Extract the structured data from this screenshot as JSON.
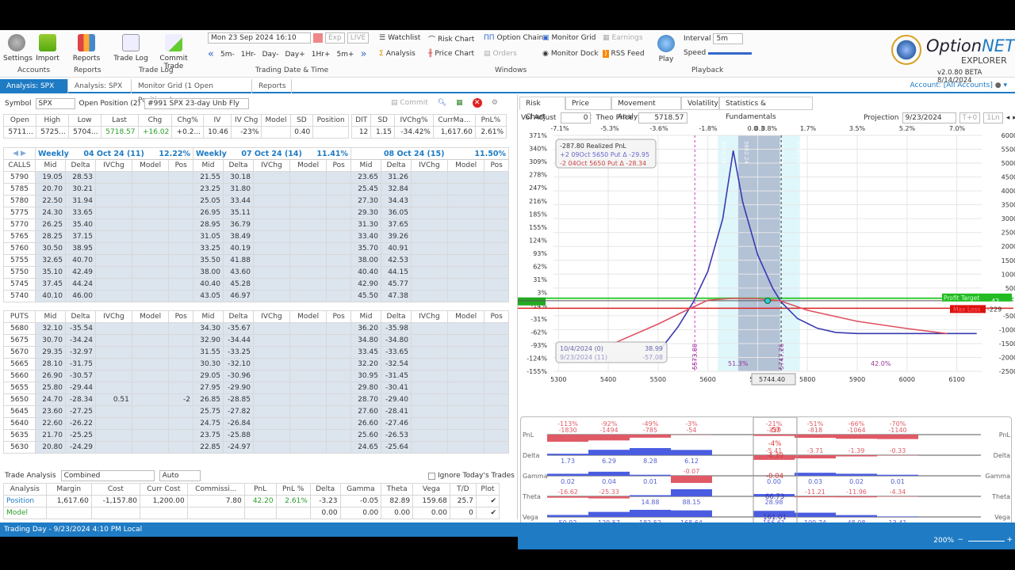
{
  "ribbon": {
    "accounts": {
      "settings": "Settings",
      "import": "Import",
      "group": "Accounts"
    },
    "reports": {
      "reports": "Reports",
      "group": "Reports"
    },
    "tradelog": {
      "trade_log": "Trade Log",
      "commit_trade": "Commit Trade",
      "group": "Trade Log"
    },
    "datetime": {
      "value": "Mon 23 Sep 2024 16:10",
      "exp": "Exp",
      "live": "LIVE",
      "steps": [
        "5m-",
        "1Hr-",
        "Day-",
        "Day+",
        "1Hr+",
        "5m+"
      ],
      "group": "Trading Date & Time"
    },
    "windows": {
      "items": [
        "Watchlist",
        "Risk Chart",
        "Option Chain",
        "Monitor Grid",
        "Earnings",
        "Analysis",
        "Price Chart",
        "Orders",
        "Monitor Dock",
        "RSS Feed"
      ],
      "group": "Windows"
    },
    "playback": {
      "play": "Play",
      "interval_label": "Interval",
      "interval": "5m",
      "speed_label": "Speed",
      "group": "Playback"
    },
    "logo": {
      "name1": "Option",
      "name2": "NET",
      "sub": "EXPLORER",
      "version": "v2.0.80 BETA 8/14/2024"
    }
  },
  "tabs": [
    "Analysis: SPX",
    "Analysis: SPX",
    "Monitor Grid (1 Open Positions)",
    "Reports"
  ],
  "account": "Account: [All Accounts]",
  "left": {
    "symbol_label": "Symbol",
    "symbol": "SPX",
    "open_position_label": "Open Position (2)",
    "position": "#991 SPX 23-day Unb Fly",
    "commit": "Commit",
    "quote_headers": [
      "Open",
      "High",
      "Low",
      "Last",
      "Chg",
      "Chg%",
      "IV",
      "IV Chg",
      "Model",
      "SD",
      "Position"
    ],
    "quote_values": [
      "5711...",
      "5725...",
      "5704...",
      "5718.57",
      "+16.02",
      "+0.2...",
      "10.46",
      "-23%",
      "",
      "0.40",
      ""
    ],
    "pos_headers": [
      "DIT",
      "SD",
      "IVChg%",
      "CurrMa...",
      "PnL%"
    ],
    "pos_values": [
      "12",
      "1.15",
      "-34.42%",
      "1,617.60",
      "2.61%"
    ],
    "expiries": [
      {
        "type": "Weekly",
        "date": "04 Oct 24 (11)",
        "iv": "12.22%"
      },
      {
        "type": "Weekly",
        "date": "07 Oct 24 (14)",
        "iv": "11.41%"
      },
      {
        "type": "",
        "date": "08 Oct 24 (15)",
        "iv": "11.50%"
      }
    ],
    "cols": [
      "Mid",
      "Delta",
      "IVChg",
      "Model",
      "Pos"
    ],
    "calls_label": "CALLS",
    "puts_label": "PUTS",
    "calls": [
      [
        "5790",
        "19.05",
        "28.53",
        "21.55",
        "30.18",
        "23.65",
        "31.26"
      ],
      [
        "5785",
        "20.70",
        "30.21",
        "23.25",
        "31.80",
        "25.45",
        "32.84"
      ],
      [
        "5780",
        "22.50",
        "31.94",
        "25.05",
        "33.44",
        "27.30",
        "34.43"
      ],
      [
        "5775",
        "24.30",
        "33.65",
        "26.95",
        "35.11",
        "29.30",
        "36.05"
      ],
      [
        "5770",
        "26.25",
        "35.40",
        "28.95",
        "36.79",
        "31.30",
        "37.65"
      ],
      [
        "5765",
        "28.25",
        "37.15",
        "31.05",
        "38.49",
        "33.40",
        "39.26"
      ],
      [
        "5760",
        "30.50",
        "38.95",
        "33.25",
        "40.19",
        "35.70",
        "40.91"
      ],
      [
        "5755",
        "32.65",
        "40.70",
        "35.50",
        "41.88",
        "38.00",
        "42.53"
      ],
      [
        "5750",
        "35.10",
        "42.49",
        "38.00",
        "43.60",
        "40.40",
        "44.15"
      ],
      [
        "5745",
        "37.45",
        "44.24",
        "40.40",
        "45.28",
        "42.90",
        "45.77"
      ],
      [
        "5740",
        "40.10",
        "46.00",
        "43.05",
        "46.97",
        "45.50",
        "47.38"
      ]
    ],
    "puts": [
      [
        "5680",
        "32.10",
        "-35.54",
        "34.30",
        "-35.67",
        "36.20",
        "-35.98"
      ],
      [
        "5675",
        "30.70",
        "-34.24",
        "32.90",
        "-34.44",
        "34.80",
        "-34.80"
      ],
      [
        "5670",
        "29.35",
        "-32.97",
        "31.55",
        "-33.25",
        "33.45",
        "-33.65"
      ],
      [
        "5665",
        "28.10",
        "-31.75",
        "30.30",
        "-32.10",
        "32.20",
        "-32.54"
      ],
      [
        "5660",
        "26.90",
        "-30.57",
        "29.05",
        "-30.96",
        "30.95",
        "-31.45"
      ],
      [
        "5655",
        "25.80",
        "-29.44",
        "27.95",
        "-29.90",
        "29.80",
        "-30.41"
      ],
      [
        "5650",
        "24.70",
        "-28.34",
        "26.85",
        "-28.85",
        "28.70",
        "-29.40"
      ],
      [
        "5645",
        "23.60",
        "-27.25",
        "25.75",
        "-27.82",
        "27.60",
        "-28.41"
      ],
      [
        "5640",
        "22.60",
        "-26.22",
        "24.75",
        "-26.84",
        "26.60",
        "-27.46"
      ],
      [
        "5635",
        "21.70",
        "-25.25",
        "23.75",
        "-25.88",
        "25.60",
        "-26.53"
      ],
      [
        "5630",
        "20.80",
        "-24.29",
        "22.85",
        "-24.97",
        "24.65",
        "-25.64"
      ]
    ],
    "put_5650_ivchg": "0.51",
    "put_5650_pos": "-2",
    "trade_analysis": {
      "label": "Trade Analysis",
      "mode": "Combined",
      "auto": "Auto",
      "ignore": "Ignore Today's Trades",
      "headers": [
        "Analysis",
        "Margin",
        "Cost",
        "Curr Cost",
        "Commissi...",
        "PnL",
        "PnL %",
        "Delta",
        "Gamma",
        "Theta",
        "Vega",
        "T/D",
        "Plot"
      ],
      "position": [
        "Position",
        "1,617.60",
        "-1,157.80",
        "1,200.00",
        "7.80",
        "42.20",
        "2.61%",
        "-3.23",
        "-0.05",
        "82.89",
        "159.68",
        "25.7"
      ],
      "model": [
        "Model",
        "",
        "",
        "",
        "",
        "",
        "",
        "0.00",
        "0.00",
        "0.00",
        "0.00",
        "0"
      ]
    }
  },
  "status": "Trading Day - 9/23/2024 4:10 PM Local",
  "right": {
    "tabs": [
      "Risk Chart",
      "Price Chart",
      "Movement Analysis",
      "Volatility",
      "Statistics & Fundamentals"
    ],
    "vol_adjust_label": "Vol Adjust",
    "vol_adjust": "0",
    "theo_label": "Theo Price",
    "theo": "5718.57",
    "projection_label": "Projection",
    "projection": "9/23/2024",
    "t0": "T+0",
    "ln": "1Ln",
    "zoom": "200%"
  },
  "chart_data": {
    "type": "line",
    "x_ticks": [
      5300,
      5400,
      5500,
      5600,
      5700,
      5800,
      5900,
      6000,
      6100
    ],
    "top_ticks": [
      "-7.1%",
      "-5.3%",
      "-3.6%",
      "-1.8%",
      "0.0",
      "0.3",
      "0.8%",
      "1.7%",
      "3.5%",
      "5.2%",
      "7.0%"
    ],
    "y_left_ticks": [
      "371%",
      "340%",
      "309%",
      "278%",
      "247%",
      "216%",
      "185%",
      "155%",
      "124%",
      "93%",
      "62%",
      "31%",
      "3%",
      "-14%",
      "-31%",
      "-62%",
      "-93%",
      "-124%",
      "-155%"
    ],
    "y_right_ticks": [
      6000,
      5500,
      5000,
      4500,
      4000,
      3500,
      3000,
      2500,
      2000,
      1500,
      1000,
      500,
      -500,
      -1000,
      -1500,
      -2000,
      -2500
    ],
    "ylim": [
      -2500,
      6000
    ],
    "xlim": [
      5290,
      6150
    ],
    "series": [
      {
        "color": "#3a3ab0",
        "points": [
          [
            5500,
            -1800
          ],
          [
            5514,
            -1500
          ],
          [
            5540,
            -900
          ],
          [
            5571,
            0
          ],
          [
            5600,
            1100
          ],
          [
            5630,
            3000
          ],
          [
            5651,
            5450
          ],
          [
            5670,
            3600
          ],
          [
            5700,
            1700
          ],
          [
            5730,
            500
          ],
          [
            5747,
            0
          ],
          [
            5780,
            -600
          ],
          [
            5820,
            -950
          ],
          [
            5857,
            -1100
          ],
          [
            5900,
            -1140
          ],
          [
            6140,
            -1140
          ]
        ]
      },
      {
        "color": "#e05060",
        "points": [
          [
            5410,
            -1500
          ],
          [
            5500,
            -800
          ],
          [
            5565,
            -229
          ],
          [
            5600,
            60
          ],
          [
            5650,
            130
          ],
          [
            5700,
            120
          ],
          [
            5745,
            40
          ],
          [
            5800,
            -300
          ],
          [
            5900,
            -700
          ],
          [
            6000,
            -960
          ],
          [
            6080,
            -1140
          ]
        ]
      }
    ],
    "profit_target": {
      "label": "Profit Target",
      "value": "42"
    },
    "max_loss": {
      "label": "Max Loss",
      "value": "-229"
    },
    "legend": [
      "-287.80 Realized PnL",
      "+2 09Oct 5650 Put Δ -29.95",
      "-2 04Oct 5650 Put Δ -28.34"
    ],
    "date_box": [
      [
        "10/4/2024 (0)",
        "38.99"
      ],
      [
        "9/23/2024 (11)",
        "-57.08"
      ]
    ],
    "vlines": [
      "5573.80",
      "5747.26"
    ],
    "band_labels": [
      "5621.94",
      "5662.24",
      "5743.66",
      "5783.10"
    ],
    "probs": [
      "51.3%",
      "42.0%"
    ],
    "cursor": "5744.40",
    "bands": {
      "outer": [
        5620,
        5785
      ],
      "inner": [
        5661,
        5745
      ]
    }
  },
  "greeks": {
    "rows": [
      "PnL",
      "Delta",
      "Gamma",
      "Theta",
      "Vega"
    ],
    "pnl_pct": [
      "-113%",
      "-92%",
      "-49%",
      "-3%",
      "",
      "-21%",
      "-51%",
      "-66%",
      "-70%"
    ],
    "pnl": [
      "-1830",
      "-1494",
      "-785",
      "-54",
      "",
      "-339",
      "-818",
      "-1064",
      "-1140"
    ],
    "delta": [
      "1.73",
      "6.29",
      "8.28",
      "6.12",
      "",
      "-5.41",
      "-3.71",
      "-1.39",
      "-0.33"
    ],
    "gamma": [
      "0.02",
      "0.04",
      "0.01",
      "-0.07",
      "",
      "0.00",
      "0.03",
      "0.02",
      "0.01"
    ],
    "theta": [
      "-16.62",
      "-25.33",
      "14.88",
      "88.15",
      "",
      "28.98",
      "-11.21",
      "-11.96",
      "-4.34"
    ],
    "vega": [
      "50.92",
      "129.57",
      "182.52",
      "168.64",
      "",
      "156.61",
      "109.74",
      "48.08",
      "13.41"
    ],
    "center": {
      "pnl": "-57",
      "pnl_pct": "-4%",
      "delta": "-4.39",
      "gamma": "-0.04",
      "theta": "66.73",
      "vega": "161.01"
    }
  }
}
